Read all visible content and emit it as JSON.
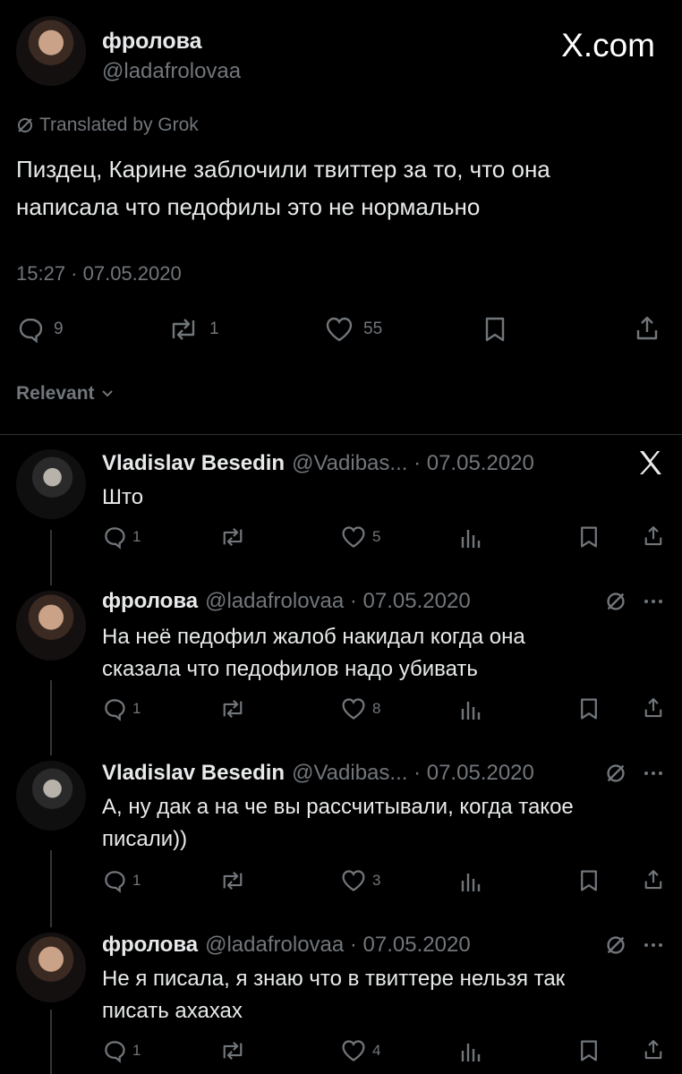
{
  "main_tweet": {
    "author_name": "фролова",
    "author_handle": "@ladafrolovaa",
    "watermark": "X.com",
    "translated_label": "Translated by Grok",
    "text_line1": "Пиздец, Карине заблочили твиттер за то, что она",
    "text_line2": "написала что педофилы это не нормально",
    "timestamp": "15:27 · 07.05.2020",
    "replies": "9",
    "reposts": "1",
    "likes": "55"
  },
  "sort": {
    "label": "Relevant"
  },
  "replies": [
    {
      "author_name": "Vladislav Besedin",
      "author_handle": "@Vadibas... · 07.05.2020",
      "text_line1": "Што",
      "text_line2": "",
      "reply_count": "1",
      "like_count": "5"
    },
    {
      "author_name": "фролова",
      "author_handle": "@ladafrolovaa · 07.05.2020",
      "text_line1": "На неё педофил жалоб накидал когда она",
      "text_line2": "сказала что педофилов надо убивать",
      "reply_count": "1",
      "like_count": "8"
    },
    {
      "author_name": "Vladislav Besedin",
      "author_handle": "@Vadibas... · 07.05.2020",
      "text_line1": "А, ну дак а на че вы рассчитывали, когда такое",
      "text_line2": "писали))",
      "reply_count": "1",
      "like_count": "3"
    },
    {
      "author_name": "фролова",
      "author_handle": "@ladafrolovaa · 07.05.2020",
      "text_line1": "Не я писала, я знаю что в твиттере нельзя так",
      "text_line2": "писать ахахах",
      "reply_count": "1",
      "like_count": "4"
    }
  ],
  "colors": {
    "background": "#000000",
    "text": "#e7e9ea",
    "muted": "#71767b",
    "divider": "#2f3336"
  },
  "icons": [
    "reply-icon",
    "repost-icon",
    "like-icon",
    "bookmark-icon",
    "share-icon",
    "views-icon",
    "grok-icon",
    "more-icon",
    "x-logo-icon"
  ]
}
